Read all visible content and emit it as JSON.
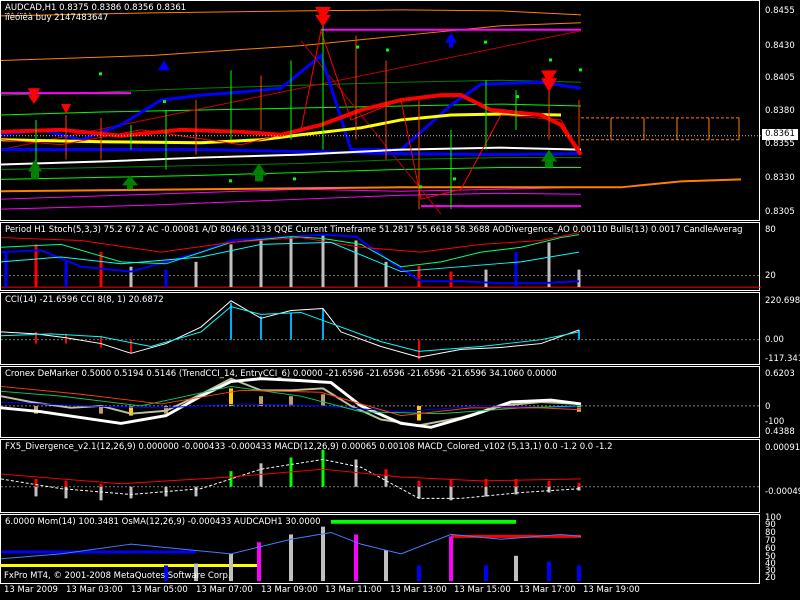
{
  "main": {
    "symbol_line": "AUDCAD,H1  0.8375 0.8386 0.8356 0.8361",
    "signal_line": "ïîêóïêà buy 2147483647",
    "scale": [
      "0.8455",
      "0.8430",
      "0.8405",
      "0.8380",
      "0.8355",
      "0.8330",
      "0.8305"
    ],
    "current_price": "0.8361"
  },
  "pane2": {
    "header": "Period H1 Stoch(5,3,3) 75.2 67.2  AC -0.00081  A/D 80466.3133  QQE Current Timeframe 51.2817 55.6618 58.3688  AODivergence_AO 0.00110  Bulls(13) 0.0017  CandleAverag",
    "scale": [
      "80",
      "20"
    ]
  },
  "pane3": {
    "header": "CCI(14) -21.6596  CCI 8(8, 1) 20.6872",
    "scale": [
      "220.6988",
      "0.00",
      "-117.3419"
    ]
  },
  "pane4": {
    "header": "Cronex DeMarker 0.5000 0.5194 0.5146  (TrendCCI_14, EntryCCI_6) 0.0000 -21.6596 -21.6596 -21.6596 -21.6596 34.1060 0.0000",
    "scale": [
      "0.6203",
      "0",
      "-100",
      "0.4388"
    ]
  },
  "pane5": {
    "header": "FX5_Divergence_v2.1(12,26,9) 0.000000 -0.000433 -0.000433  MACD(12,26,9) 0.00065 0.00108  MACD_Colored_v102 (5,13,1) 0.0 -1.2 0.0 -1.2",
    "scale": [
      "0.000913",
      "-0.000491"
    ]
  },
  "pane6": {
    "header": "6.0000  Mom(14) 100.3481  OsMA(12,26,9) -0.000433  AUDCADH1 30.0000",
    "scale": [
      "100",
      "90",
      "80",
      "70",
      "60",
      "50",
      "40",
      "30",
      "20"
    ],
    "copyright": "FxPro MT4, © 2001-2008 MetaQuotes Software Corp."
  },
  "time_axis": [
    "13 Mar 2009",
    "13 Mar 03:00",
    "13 Mar 05:00",
    "13 Mar 07:00",
    "13 Mar 09:00",
    "13 Mar 11:00",
    "13 Mar 13:00",
    "13 Mar 15:00",
    "13 Mar 17:00",
    "13 Mar 19:00"
  ],
  "colors": {
    "background": "#000000",
    "bull_arrow": "#008000",
    "bear_arrow": "#ff0000",
    "buy_arrow": "#0000ff",
    "ma_red": "#ff0000",
    "ma_yellow": "#ffff00",
    "ma_blue": "#0000ff",
    "macd_bar": "#c0c0c0",
    "magenta": "#ff00ff"
  }
}
